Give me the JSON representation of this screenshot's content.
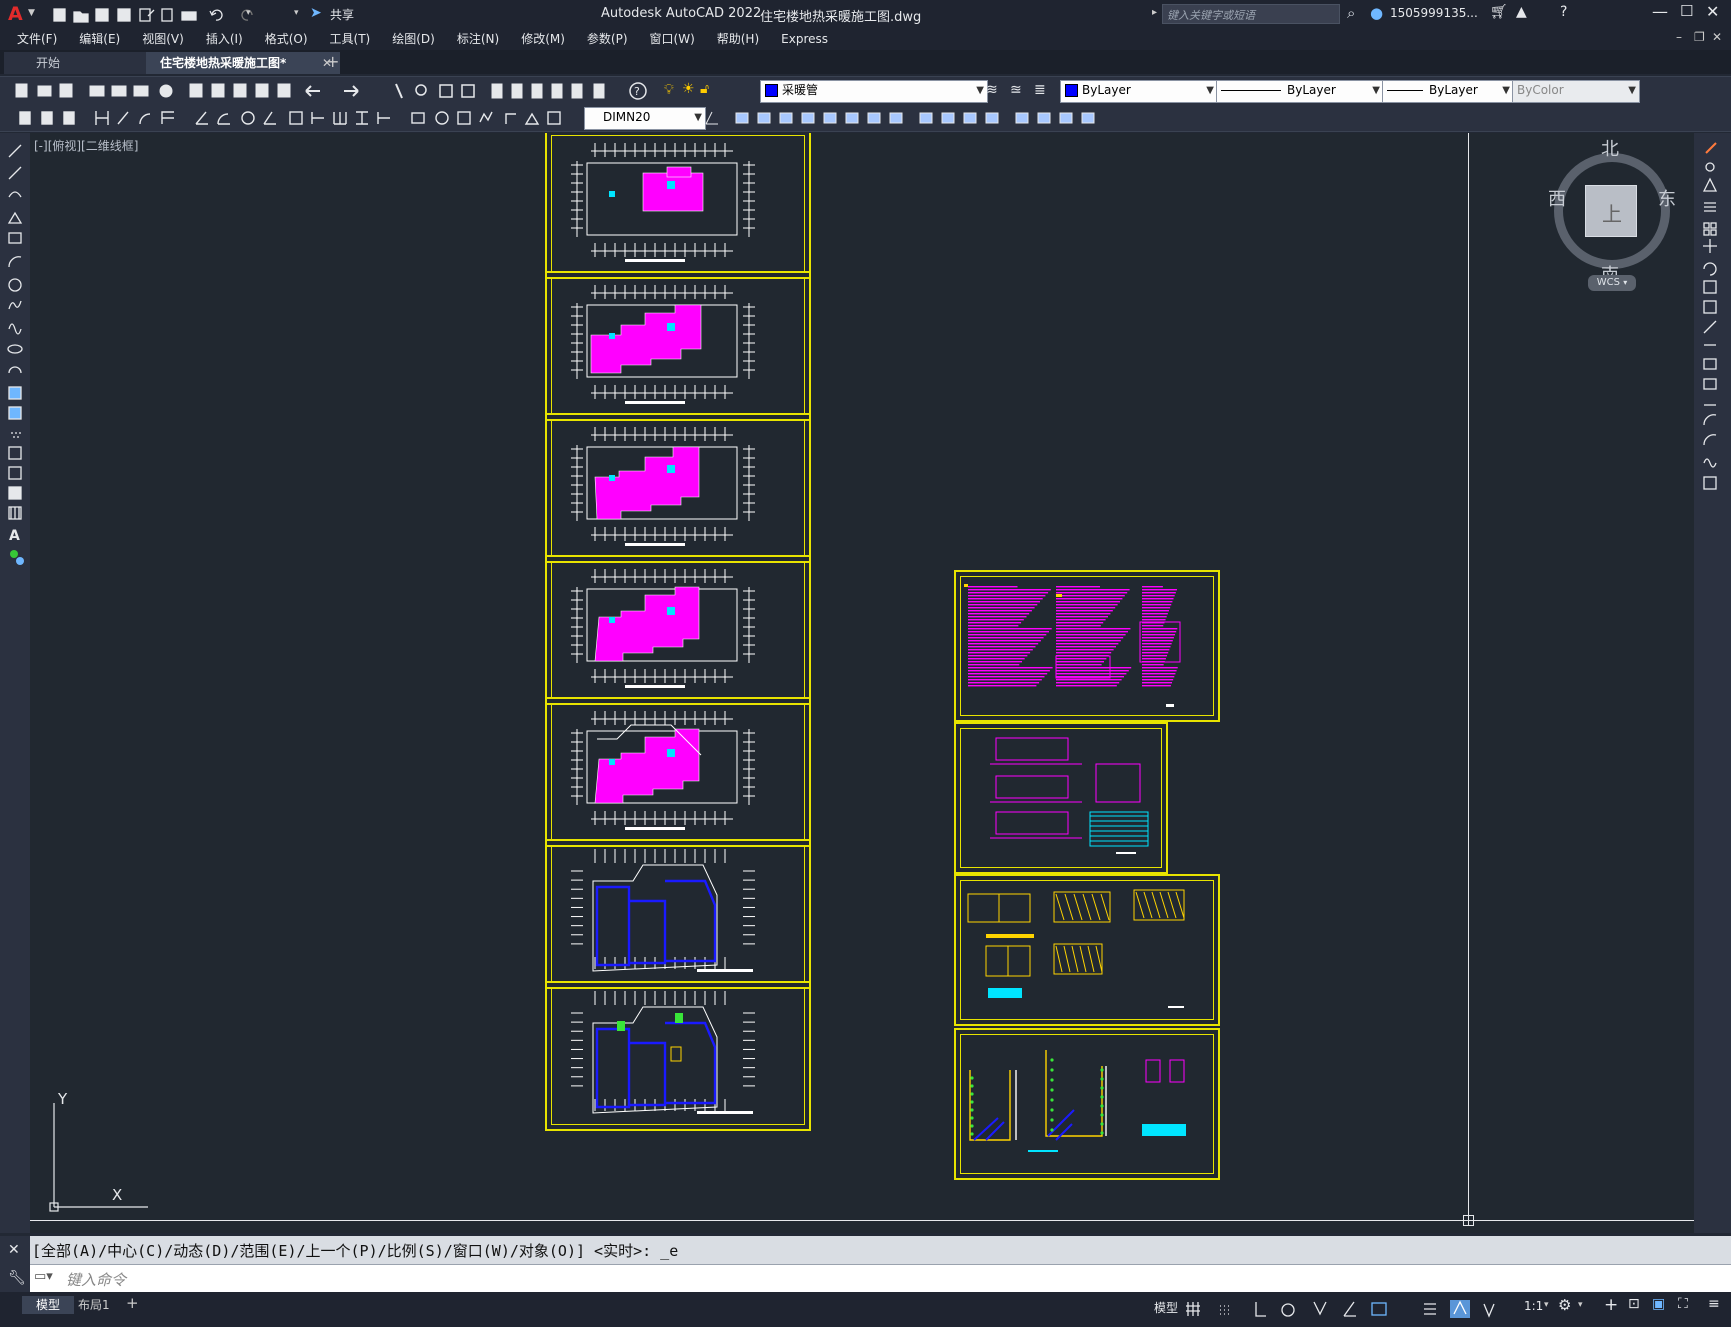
{
  "title_bar": {
    "app_title": "Autodesk AutoCAD 2022",
    "file_name": "住宅楼地热采暖施工图.dwg",
    "share_label": "共享",
    "search_placeholder": "键入关键字或短语",
    "user_name": "1505999135..."
  },
  "menu": {
    "items": [
      "文件(F)",
      "编辑(E)",
      "视图(V)",
      "插入(I)",
      "格式(O)",
      "工具(T)",
      "绘图(D)",
      "标注(N)",
      "修改(M)",
      "参数(P)",
      "窗口(W)",
      "帮助(H)",
      "Express"
    ]
  },
  "tabs": [
    {
      "label": "开始"
    },
    {
      "label": "住宅楼地热采暖施工图*"
    }
  ],
  "properties": {
    "layer_name": "采暖管",
    "color": "ByLayer",
    "linetype": "ByLayer",
    "lineweight": "ByLayer",
    "plotstyle": "ByColor",
    "dimstyle": "DIMN20"
  },
  "viewport": {
    "label": "[-][俯视][二维线框]",
    "compass": {
      "north": "北",
      "south": "南",
      "east": "东",
      "west": "西",
      "center": "上"
    },
    "wcs_label": "WCS",
    "ucs": {
      "x": "X",
      "y": "Y"
    }
  },
  "command": {
    "history": "[全部(A)/中心(C)/动态(D)/范围(E)/上一个(P)/比例(S)/窗口(W)/对象(O)] <实时>: _e",
    "placeholder": "键入命令"
  },
  "layout_tabs": [
    "模型",
    "布局1"
  ],
  "status": {
    "model_label": "模型",
    "scale": "1:1"
  },
  "colors": {
    "sheet_border": "#e8e400",
    "fill_magenta": "#ff00ff",
    "fill_blue": "#1a1aff",
    "fill_cyan": "#00e5ff",
    "accent": "#ffd400"
  }
}
